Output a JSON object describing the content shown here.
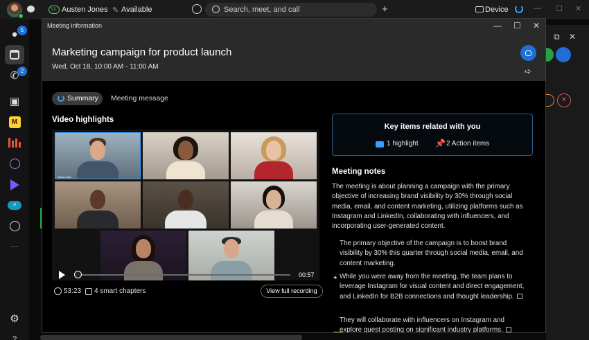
{
  "topbar": {
    "initials": "LL",
    "user_name": "Austen Jones",
    "status": "Available",
    "search_placeholder": "Search, meet, and call",
    "device_label": "Device"
  },
  "sidebar": {
    "messages_badge": "5",
    "calls_badge": "2",
    "more_label": "···"
  },
  "modal": {
    "window_label": "Meeting information",
    "title": "Marketing campaign for product launch",
    "datetime": "Wed, Oct 18, 10:00 AM - 11:00 AM",
    "tabs": [
      {
        "label": "Summary",
        "active": true
      },
      {
        "label": "Meeting message",
        "active": false
      }
    ],
    "video": {
      "section_title": "Video highlights",
      "selected_participant_label": "David Liam",
      "current_time": "00:57",
      "duration": "53:23",
      "chapters": "4 smart chapters",
      "full_recording_label": "View full recording"
    },
    "key_items": {
      "title": "Key items related with you",
      "highlight": "1 highlight",
      "actions": "2 Action items"
    },
    "notes": {
      "title": "Meeting notes",
      "intro": "The meeting is about planning a campaign with the primary objective of increasing brand visibility by 30% through social media, email, and content marketing, utilizing platforms such as Instagram and LinkedIn, collaborating with influencers, and incorporating user-generated content.",
      "bullets": [
        "The primary objective of the campaign is to boost brand visibility by 30% this quarter through social media, email, and content marketing.",
        "While you were away from the meeting, the team plans to leverage Instagram for visual content and direct engagement, and LinkedIn for B2B connections and thought leadership.",
        "They will collaborate with influencers on Instagram and explore guest posting on significant industry platforms."
      ]
    }
  },
  "colors": {
    "accent": "#1f6fd6",
    "ai_blue": "#3aa0ff",
    "available_green": "#3fb950"
  }
}
